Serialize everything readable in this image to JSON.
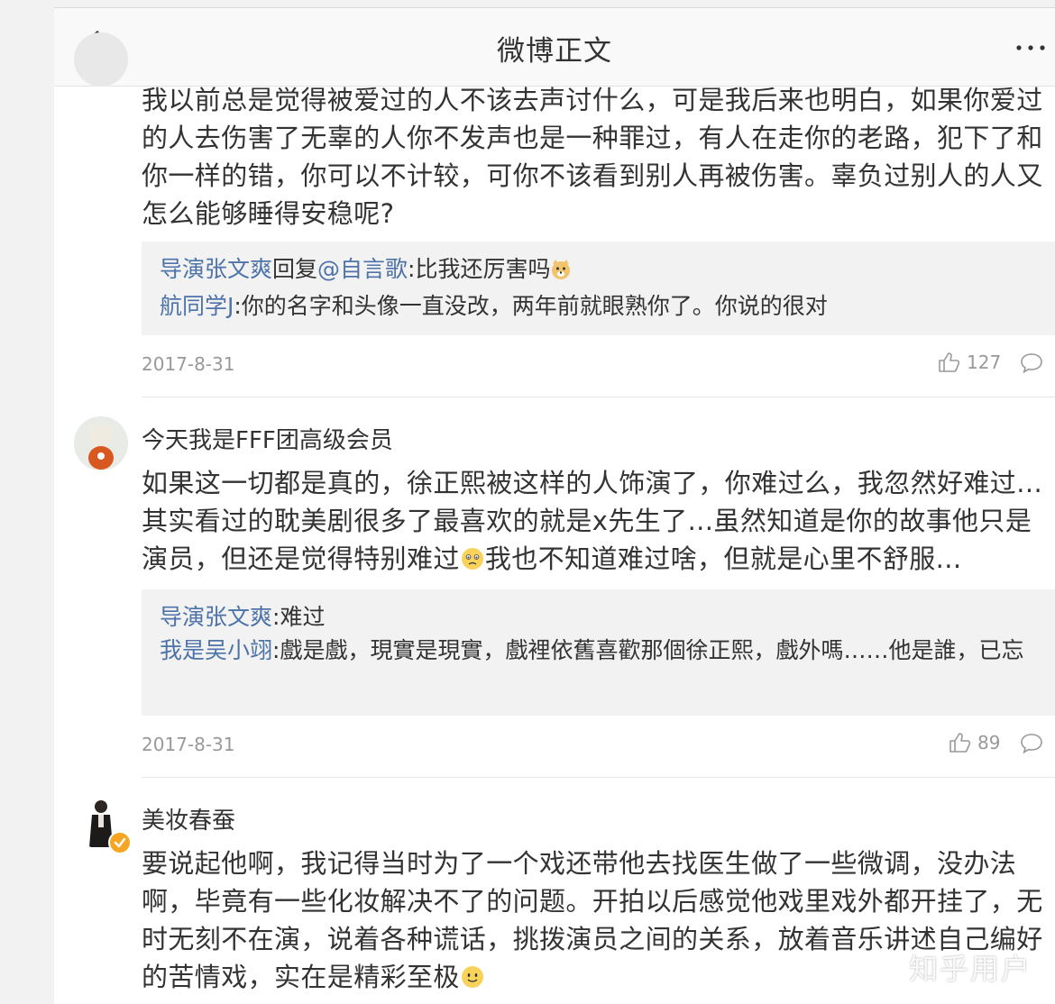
{
  "nav": {
    "title": "微博正文"
  },
  "comments": [
    {
      "text": "我以前总是觉得被爱过的人不该去声讨什么，可是我后来也明白，如果你爱过的人去伤害了无辜的人你不发声也是一种罪过，有人在走你的老路，犯下了和你一样的错，你可以不计较，可你不该看到别人再被伤害。辜负过别人的人又怎么能够睡得安稳呢?",
      "replies": [
        {
          "name": "导演张文爽",
          "mid": "回复",
          "target": "@自言歌",
          "text": ":比我还厉害吗"
        },
        {
          "name": "航同学J",
          "text": ":你的名字和头像一直没改，两年前就眼熟你了。你说的很对"
        }
      ],
      "date": "2017-8-31",
      "likes": "127"
    },
    {
      "user": "今天我是FFF团高级会员",
      "text_a": "如果这一切都是真的，徐正熙被这样的人饰演了，你难过么，我忽然好难过...其实看过的耽美剧很多了最喜欢的就是x先生了...虽然知道是你的故事他只是演员，但还是觉得特别难过",
      "text_b": "我也不知道难过啥，但就是心里不舒服...",
      "replies": [
        {
          "name": "导演张文爽",
          "text": ":难过"
        },
        {
          "name": "我是吴小翊",
          "text": ":戲是戲，現實是現實，戲裡依舊喜歡那個徐正熙，戲外嗎……他是誰，已忘"
        }
      ],
      "date": "2017-8-31",
      "likes": "89"
    },
    {
      "user": "美妆春蚕",
      "text": "要说起他啊，我记得当时为了一个戏还带他去找医生做了一些微调，没办法啊，毕竟有一些化妆解决不了的问题。开拍以后感觉他戏里戏外都开挂了，无时无刻不在演，说着各种谎话，挑拨演员之间的关系，放着音乐讲述自己编好的苦情戏，实在是精彩至极"
    }
  ],
  "watermark": "知乎用户",
  "colors": {
    "link": "#4d73a8",
    "meta": "#999999",
    "reply_bg": "#f2f2f2"
  }
}
